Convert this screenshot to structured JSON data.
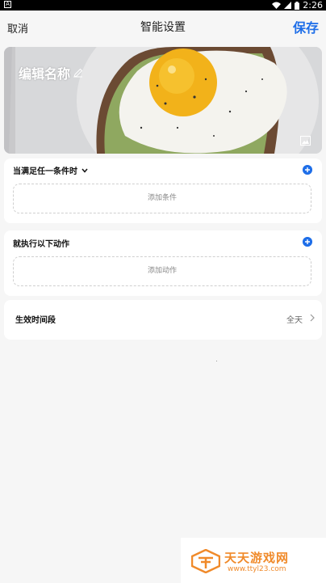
{
  "statusbar": {
    "time": "2:26",
    "icons": [
      "notification-icon",
      "wifi-icon",
      "signal-icon",
      "battery-icon"
    ]
  },
  "navbar": {
    "cancel": "取消",
    "title": "智能设置",
    "save": "保存"
  },
  "banner": {
    "name": "编辑名称"
  },
  "conditions": {
    "title": "当满足任一条件时",
    "add": "添加条件"
  },
  "actions": {
    "title": "就执行以下动作",
    "add": "添加动作"
  },
  "period": {
    "label": "生效时间段",
    "value": "全天"
  },
  "watermark": {
    "name": "天天游戏网",
    "url": "www.ttyl23.com"
  },
  "colors": {
    "accent": "#1e6ee8",
    "watermark": "#f08a2a",
    "background": "#f6f6f6"
  }
}
